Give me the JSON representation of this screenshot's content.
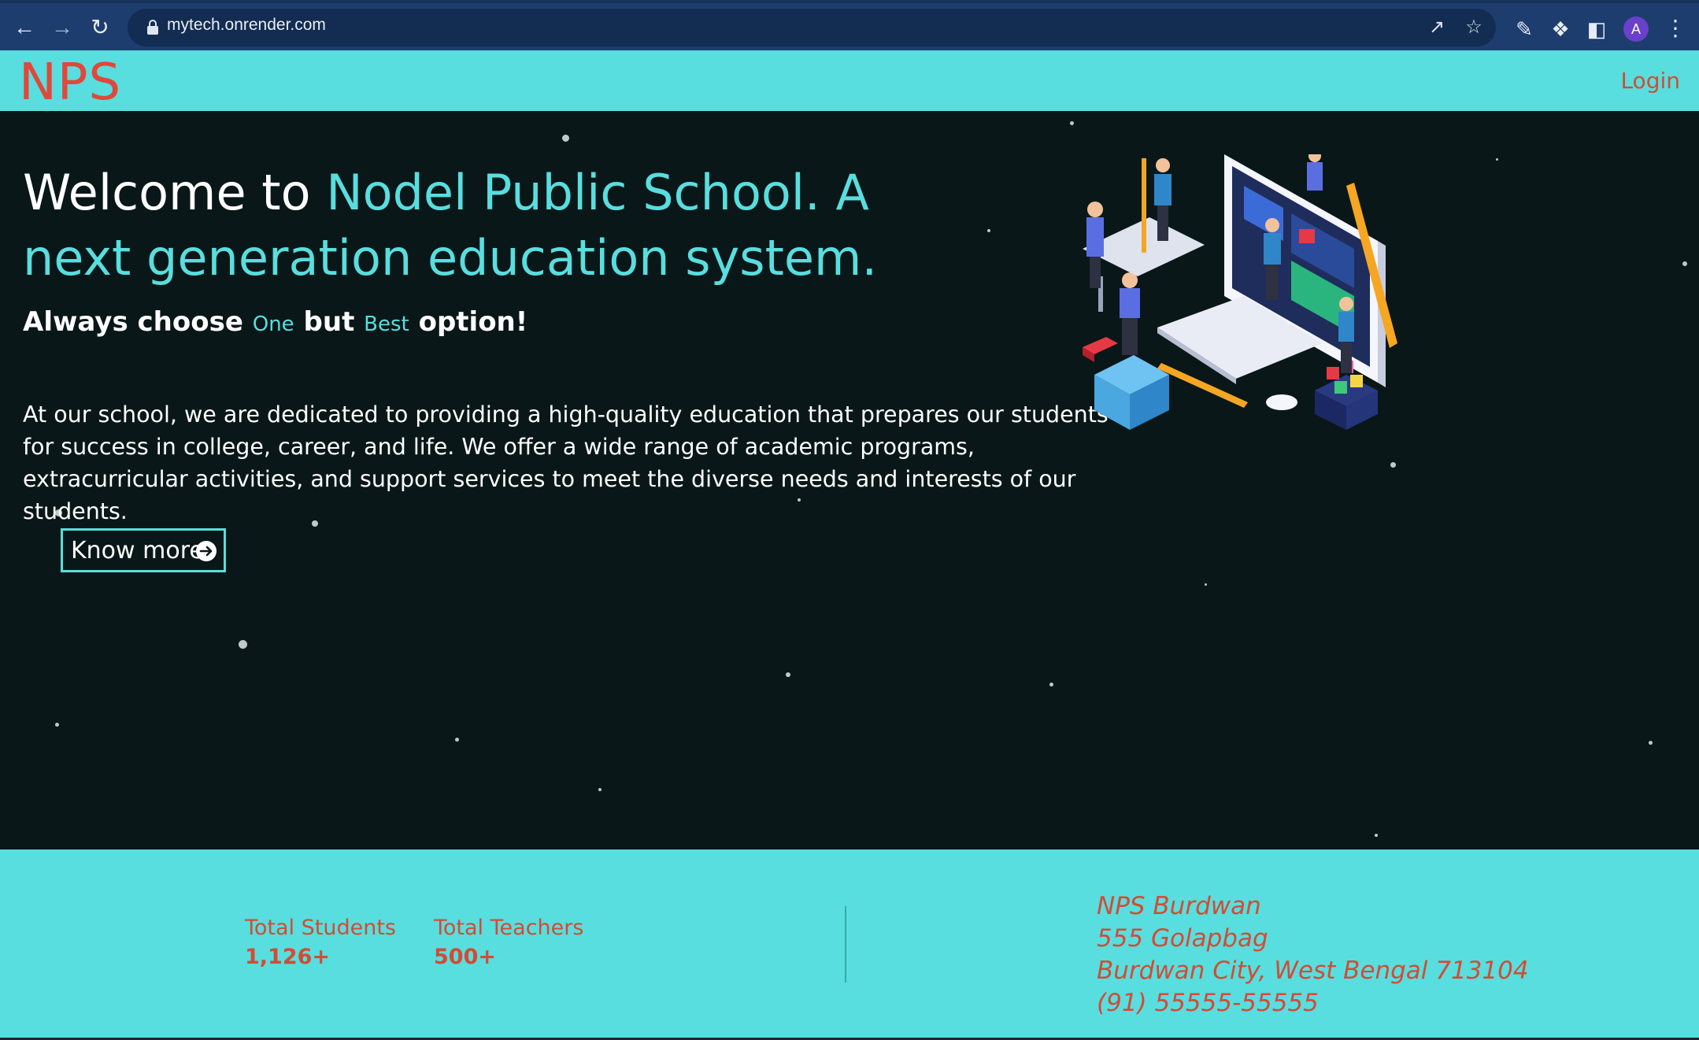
{
  "browser": {
    "url": "mytech.onrender.com",
    "back_icon": "arrow-left-icon",
    "forward_icon": "arrow-right-icon",
    "reload_icon": "reload-icon",
    "profile_initial": "A"
  },
  "nav": {
    "logo": "NPS",
    "login_label": "Login"
  },
  "hero": {
    "title_prefix": "Welcome to ",
    "title_accent": "Nodel Public School. A next generation education system.",
    "tagline_start": "Always choose ",
    "tagline_one": "One",
    "tagline_mid": " but ",
    "tagline_best": "Best",
    "tagline_end": " option!",
    "intro": "At our school, we are dedicated to providing a high-quality education that prepares our students for success in college, career, and life. We offer a wide range of academic programs, extracurricular activities, and support services to meet the diverse needs and interests of our students.",
    "cta_label": "Know more"
  },
  "footer": {
    "students_label": "Total Students",
    "students_value": "1,126+",
    "teachers_label": "Total Teachers",
    "teachers_value": "500+",
    "address": {
      "name": "NPS Burdwan",
      "street": "555 Golapbag",
      "city": "Burdwan City, West Bengal 713104",
      "phone": "(91) 55555-55555"
    }
  },
  "colors": {
    "accent": "#58dede",
    "brand_red": "#e2473b",
    "hero_bg": "#0a1718",
    "chrome_bg": "#1c3d6e"
  }
}
